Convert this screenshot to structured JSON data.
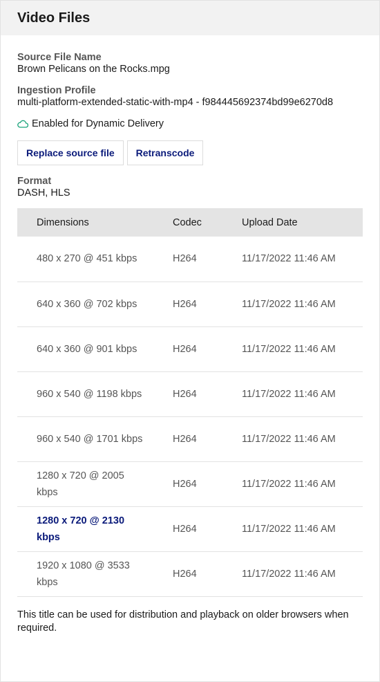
{
  "panel": {
    "title": "Video Files"
  },
  "source": {
    "label": "Source File Name",
    "value": "Brown Pelicans on the Rocks.mpg"
  },
  "ingestion": {
    "label": "Ingestion Profile",
    "value": "multi-platform-extended-static-with-mp4 - f984445692374bd99e6270d8"
  },
  "dynamic_delivery": {
    "icon": "cloud-icon",
    "text": "Enabled for Dynamic Delivery",
    "icon_color": "#1aa37a"
  },
  "buttons": {
    "replace": "Replace source file",
    "retranscode": "Retranscode"
  },
  "format": {
    "label": "Format",
    "value": "DASH, HLS"
  },
  "table": {
    "headers": {
      "dimensions": "Dimensions",
      "codec": "Codec",
      "upload_date": "Upload Date"
    },
    "rows": [
      {
        "dimensions": "480 x 270 @ 451 kbps",
        "codec": "H264",
        "date": "11/17/2022 11:46 AM"
      },
      {
        "dimensions": "640 x 360 @ 702 kbps",
        "codec": "H264",
        "date": "11/17/2022 11:46 AM"
      },
      {
        "dimensions": "640 x 360 @ 901 kbps",
        "codec": "H264",
        "date": "11/17/2022 11:46 AM"
      },
      {
        "dimensions": "960 x 540 @ 1198 kbps",
        "codec": "H264",
        "date": "11/17/2022 11:46 AM"
      },
      {
        "dimensions": "960 x 540 @ 1701 kbps",
        "codec": "H264",
        "date": "11/17/2022 11:46 AM"
      },
      {
        "dimensions": "1280 x 720 @ 2005 kbps",
        "codec": "H264",
        "date": "11/17/2022 11:46 AM"
      },
      {
        "dimensions": "1280 x 720 @ 2130 kbps",
        "codec": "H264",
        "date": "11/17/2022 11:46 AM"
      },
      {
        "dimensions": "1920 x 1080 @ 3533 kbps",
        "codec": "H264",
        "date": "11/17/2022 11:46 AM"
      }
    ]
  },
  "footnote": "This title can be used for distribution and playback on older browsers when required.",
  "colors": {
    "link": "#0a1a7a",
    "header_bg": "#f2f2f2",
    "table_header_bg": "#e4e4e4"
  }
}
